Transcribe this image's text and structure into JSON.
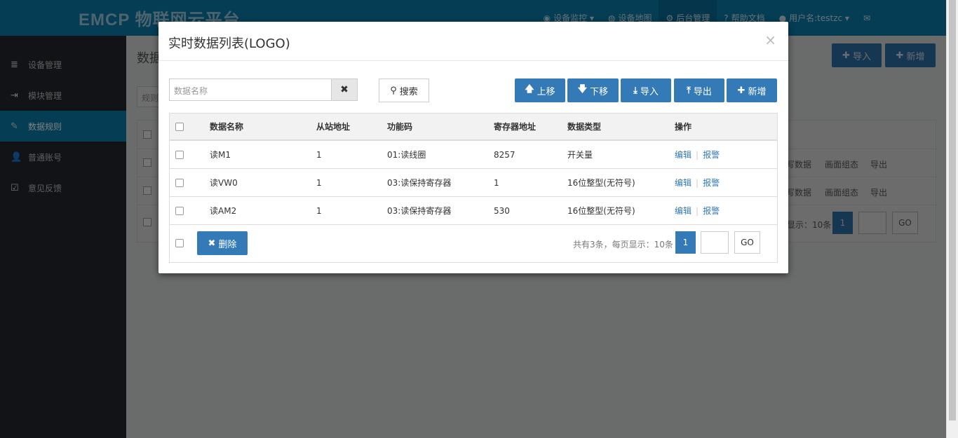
{
  "app": {
    "logo": "EMCP 物联网云平台"
  },
  "nav": [
    {
      "icon": "monitor-icon",
      "label": "设备监控 ▾"
    },
    {
      "icon": "globe-icon",
      "label": "设备地图"
    },
    {
      "icon": "gears-icon",
      "label": "后台管理"
    },
    {
      "icon": "help-icon",
      "label": "帮助文档"
    },
    {
      "icon": "user-icon",
      "label": "用户名:testzc ▾"
    },
    {
      "icon": "mail-icon",
      "label": "✉"
    }
  ],
  "sidebar": {
    "items": [
      {
        "icon": "≣",
        "label": "设备管理"
      },
      {
        "icon": "⇥",
        "label": "模块管理"
      },
      {
        "icon": "✎",
        "label": "数据规则"
      },
      {
        "icon": "👤",
        "label": "普通账号"
      },
      {
        "icon": "☑",
        "label": "意见反馈"
      }
    ]
  },
  "background": {
    "page_title": "数据",
    "import_label": "导入",
    "add_label": "新增",
    "filter_placeholder": "规则",
    "row_links": [
      "写数据",
      "画面组态",
      "导出"
    ],
    "pager_info": "显示：10条",
    "pager_page": "1",
    "go_label": "GO"
  },
  "modal": {
    "title": "实时数据列表(LOGO)",
    "close": "×",
    "search_placeholder": "数据名称",
    "clear_icon": "✖",
    "search_label": "搜索",
    "buttons": {
      "up": "上移",
      "down": "下移",
      "import": "导入",
      "export": "导出",
      "add": "新增"
    },
    "table": {
      "headers": [
        "数据名称",
        "从站地址",
        "功能码",
        "寄存器地址",
        "数据类型",
        "操作"
      ],
      "rows": [
        {
          "name": "读M1",
          "slave": "1",
          "func": "01:读线圈",
          "reg": "8257",
          "type": "开关量",
          "edit": "编辑",
          "alarm": "报警"
        },
        {
          "name": "读VW0",
          "slave": "1",
          "func": "03:读保持寄存器",
          "reg": "1",
          "type": "16位整型(无符号)",
          "edit": "编辑",
          "alarm": "报警"
        },
        {
          "name": "读AM2",
          "slave": "1",
          "func": "03:读保持寄存器",
          "reg": "530",
          "type": "16位整型(无符号)",
          "edit": "编辑",
          "alarm": "报警"
        }
      ]
    },
    "delete_label": "删除",
    "pager": {
      "info": "共有3条，每页显示：10条",
      "page": "1",
      "go": "GO"
    }
  }
}
